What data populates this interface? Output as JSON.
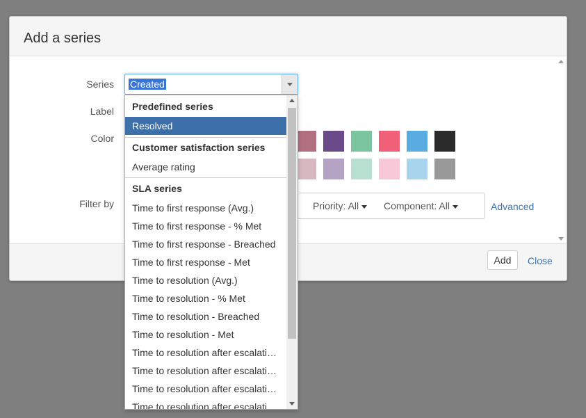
{
  "dialog": {
    "title": "Add a series",
    "labels": {
      "series": "Series",
      "label": "Label",
      "color": "Color",
      "filter_by": "Filter by"
    },
    "series_select": {
      "value": "Created"
    },
    "colors_row1": [
      "#b07080",
      "#6b4a8a",
      "#7ac4a0",
      "#f06078",
      "#5aabe0",
      "#2b2b2b"
    ],
    "colors_row2": [
      "#d8b8c0",
      "#b4a3c4",
      "#b8e0d0",
      "#f8c8d8",
      "#a8d4ee",
      "#999999"
    ],
    "filters": {
      "priority": "Priority: All",
      "component": "Component: All",
      "advanced": "Advanced"
    },
    "footer": {
      "add": "Add",
      "close": "Close"
    }
  },
  "dropdown": {
    "predefined_group": "Predefined series",
    "resolved": "Resolved",
    "csat_group": "Customer satisfaction series",
    "average_rating": "Average rating",
    "sla_group": "SLA series",
    "sla_items": [
      "Time to first response (Avg.)",
      "Time to first response - % Met",
      "Time to first response - Breached",
      "Time to first response - Met",
      "Time to resolution (Avg.)",
      "Time to resolution - % Met",
      "Time to resolution - Breached",
      "Time to resolution - Met",
      "Time to resolution after escalati…",
      "Time to resolution after escalati…",
      "Time to resolution after escalati…",
      "Time to resolution after escalati"
    ]
  }
}
